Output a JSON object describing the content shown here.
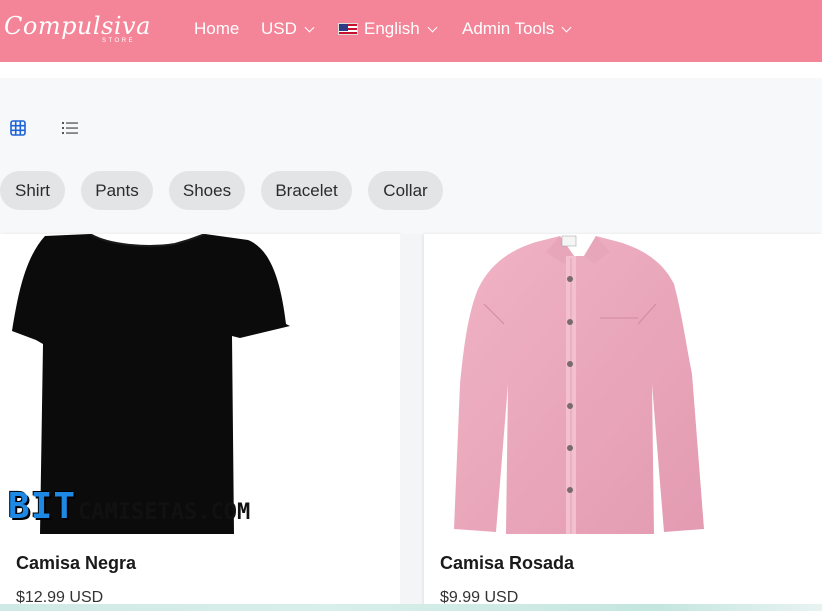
{
  "brand": {
    "logo_text": "Compulsiva",
    "logo_sub": "STORE"
  },
  "nav": {
    "home": "Home",
    "currency": "USD",
    "language": "English",
    "admin": "Admin Tools"
  },
  "view_toggle": {
    "active": "grid",
    "icons": [
      "grid-icon",
      "list-icon"
    ]
  },
  "categories": [
    "Shirt",
    "Pants",
    "Shoes",
    "Bracelet",
    "Collar"
  ],
  "products": [
    {
      "title": "Camisa Negra",
      "price": "$12.99 USD",
      "watermark_a": "BIT",
      "watermark_b": "CAMISETAS.COM"
    },
    {
      "title": "Camisa Rosada",
      "price": "$9.99 USD"
    }
  ],
  "colors": {
    "navbar": "#f48497",
    "accent_blue": "#1e88e5",
    "chip_bg": "#e3e4e6"
  }
}
